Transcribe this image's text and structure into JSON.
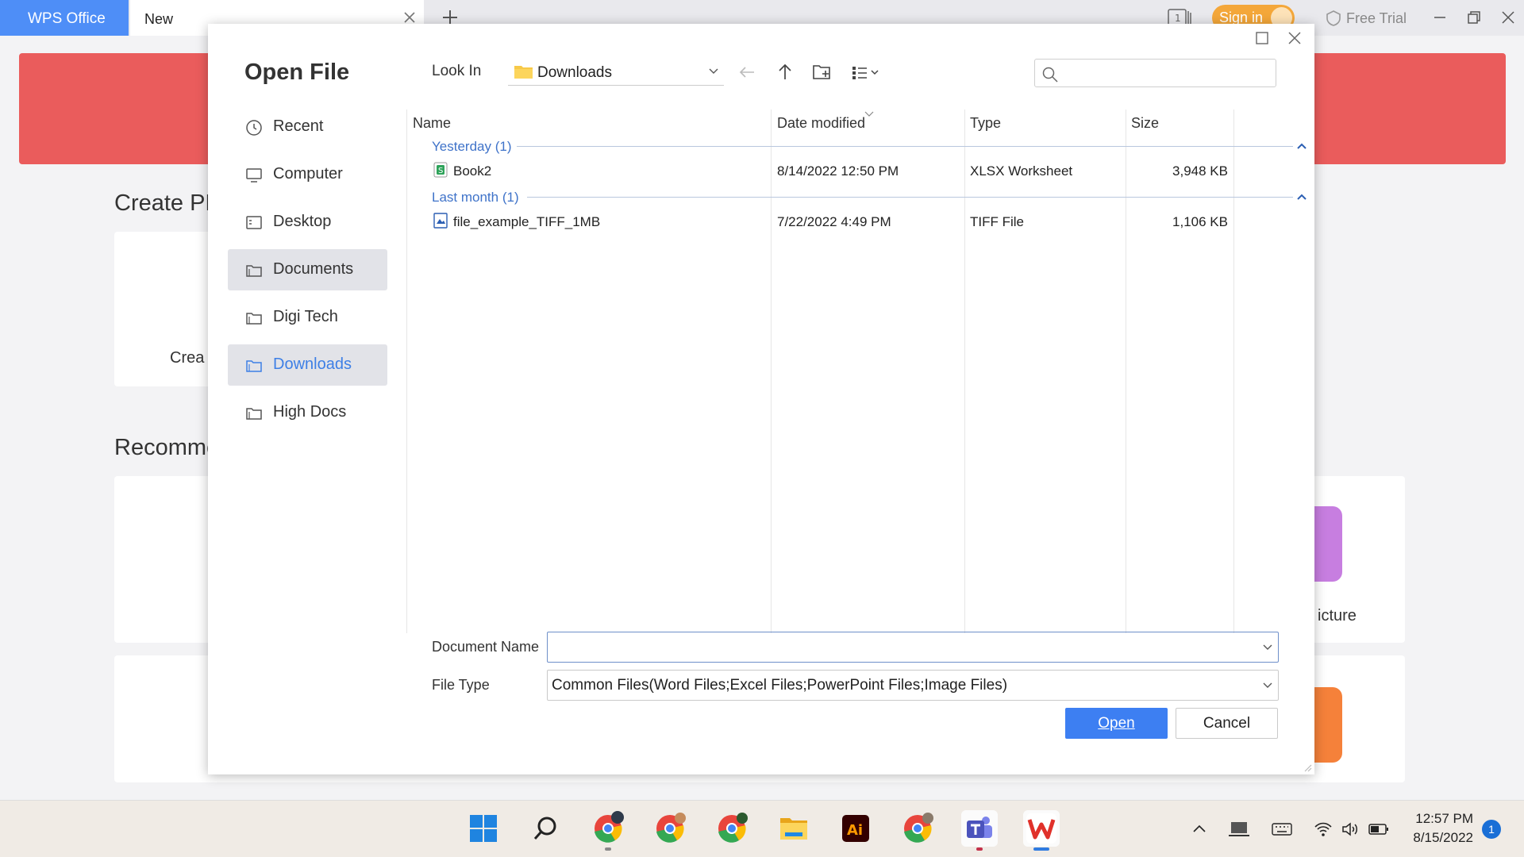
{
  "wps": {
    "app_tab": "WPS Office",
    "doc_tab": "New",
    "tab_count": "1",
    "sign_in": "Sign in",
    "free_trial": "Free Trial",
    "create_heading": "Create PD",
    "create_card_text": "Crea",
    "recommend_heading": "Recomme",
    "picture_label": "icture"
  },
  "dialog": {
    "title": "Open File",
    "nav": [
      {
        "label": "Recent",
        "icon": "clock-icon"
      },
      {
        "label": "Computer",
        "icon": "monitor-icon"
      },
      {
        "label": "Desktop",
        "icon": "desktop-icon"
      },
      {
        "label": "Documents",
        "icon": "folder-icon",
        "selected": true
      },
      {
        "label": "Digi Tech",
        "icon": "folder-icon"
      },
      {
        "label": "Downloads",
        "icon": "folder-icon",
        "selected": true,
        "active": true
      },
      {
        "label": "High Docs",
        "icon": "folder-icon"
      }
    ],
    "look_in_label": "Look In",
    "look_in_value": "Downloads",
    "search_placeholder": "",
    "columns": {
      "name": "Name",
      "date": "Date modified",
      "type": "Type",
      "size": "Size"
    },
    "groups": [
      {
        "label": "Yesterday (1)",
        "files": [
          {
            "name": "Book2",
            "date": "8/14/2022 12:50 PM",
            "type": "XLSX Worksheet",
            "size": "3,948 KB",
            "icon": "spreadsheet-icon"
          }
        ]
      },
      {
        "label": "Last month (1)",
        "files": [
          {
            "name": "file_example_TIFF_1MB",
            "date": "7/22/2022 4:49 PM",
            "type": "TIFF File",
            "size": "1,106 KB",
            "icon": "image-file-icon"
          }
        ]
      }
    ],
    "document_name_label": "Document Name",
    "document_name_value": "",
    "file_type_label": "File Type",
    "file_type_value": "Common Files(Word Files;Excel Files;PowerPoint Files;Image Files)",
    "open_button": "Open",
    "cancel_button": "Cancel"
  },
  "taskbar": {
    "apps": [
      "start-icon",
      "search-icon",
      "chrome-icon",
      "chrome-icon",
      "chrome-icon",
      "file-explorer-icon",
      "illustrator-icon",
      "chrome-icon",
      "teams-icon",
      "wps-icon"
    ],
    "illustrator_text": "Ai",
    "time": "12:57 PM",
    "date": "8/15/2022",
    "notification_count": "1"
  },
  "colors": {
    "accent": "#3d7ff2",
    "wps_tab": "#4e8ef7",
    "hero": "#ea5c5c",
    "sign_in": "#f4a73a",
    "group_label": "#3f73c9"
  }
}
